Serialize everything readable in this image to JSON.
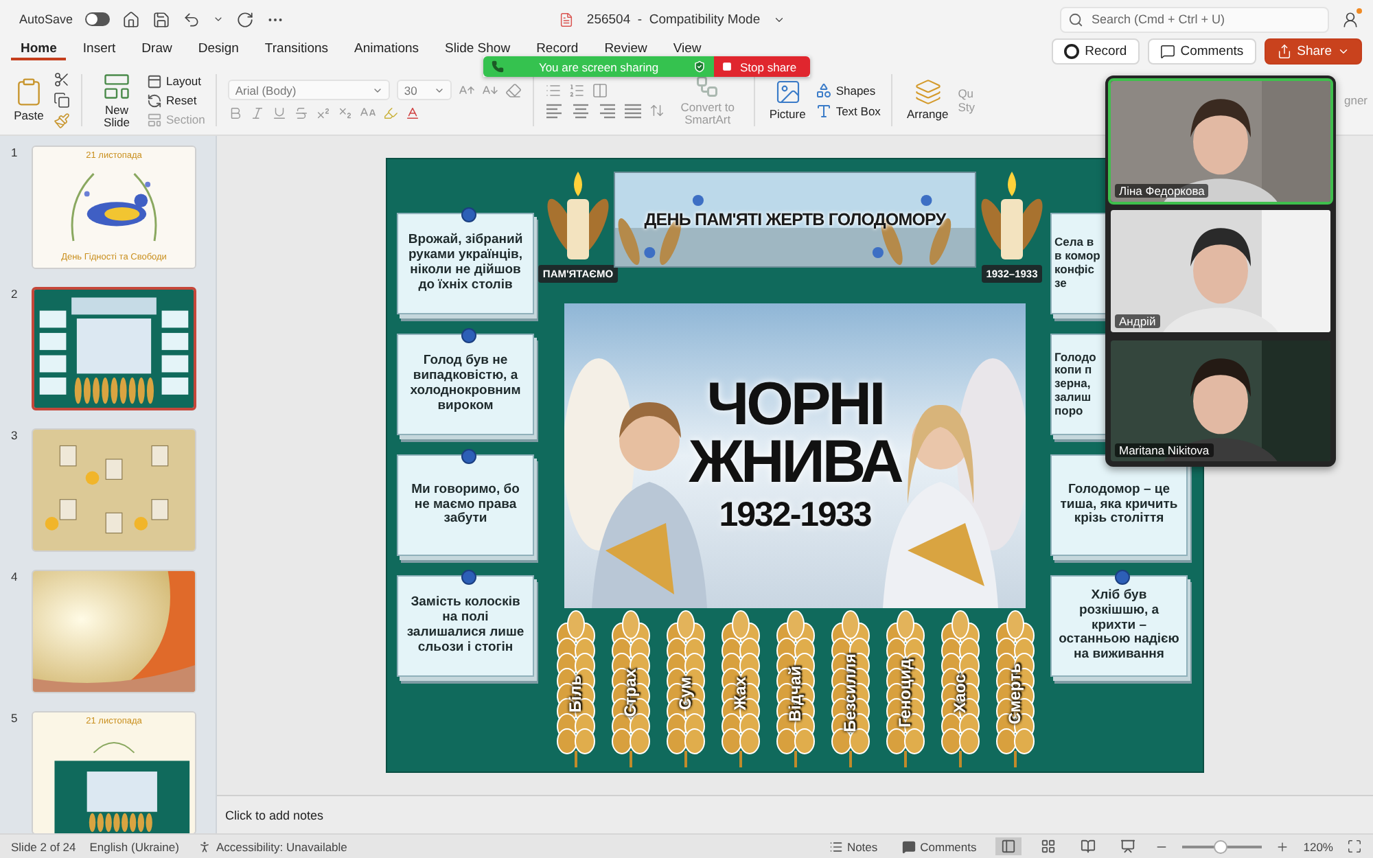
{
  "title_bar": {
    "autosave_label": "AutoSave",
    "autosave_on": false,
    "document_title": "256504  -  Compatibility Mode",
    "search": {
      "placeholder": "Search (Cmd + Ctrl + U)"
    }
  },
  "tabs": [
    {
      "label": "Home",
      "selected": true
    },
    {
      "label": "Insert",
      "selected": false
    },
    {
      "label": "Draw",
      "selected": false
    },
    {
      "label": "Design",
      "selected": false
    },
    {
      "label": "Transitions",
      "selected": false
    },
    {
      "label": "Animations",
      "selected": false
    },
    {
      "label": "Slide Show",
      "selected": false
    },
    {
      "label": "Record",
      "selected": false
    },
    {
      "label": "Review",
      "selected": false
    },
    {
      "label": "View",
      "selected": false
    }
  ],
  "header_buttons": [
    {
      "kind": "record",
      "label": "Record"
    },
    {
      "kind": "comments",
      "label": "Comments"
    },
    {
      "kind": "share",
      "label": "Share"
    }
  ],
  "ribbon": {
    "paste": "Paste",
    "new_slide": "New Slide",
    "slide_commands": [
      {
        "kind": "layout",
        "label": "Layout",
        "disabled": false
      },
      {
        "kind": "reset",
        "label": "Reset",
        "disabled": false
      },
      {
        "kind": "section",
        "label": "Section",
        "disabled": true
      }
    ],
    "font_name": "Arial (Body)",
    "font_size": "30",
    "smartart": {
      "label": "Convert to SmartArt",
      "disabled": true
    },
    "picture": "Picture",
    "shapes": "Shapes",
    "text_box": "Text Box",
    "arrange": "Arrange",
    "quick_styles": "Qu\nSty",
    "designer": "gner"
  },
  "sharing_banner": {
    "message": "You are screen sharing",
    "stop": "Stop share"
  },
  "thumbnails": [
    {
      "number": "1",
      "kind": "dove",
      "selected": false,
      "texts": [
        "21 листопада",
        "День Гідності та Свободи"
      ]
    },
    {
      "number": "2",
      "kind": "poster",
      "selected": true
    },
    {
      "number": "3",
      "kind": "portraits",
      "selected": false
    },
    {
      "number": "4",
      "kind": "gradient",
      "selected": false
    },
    {
      "number": "5",
      "kind": "collage",
      "selected": false,
      "texts": [
        "21 листопада"
      ]
    }
  ],
  "slide": {
    "banner_title": "ДЕНЬ ПАМ'ЯТІ ЖЕРТВ ГОЛОДОМОРУ",
    "left_candle_label": "ПАМ'ЯТАЄМО",
    "right_candle_label": "1932–1933",
    "left_cards": [
      "Врожай, зібраний руками українців, ніколи не дійшов до їхніх столів",
      "Голод був не випадковістю, а холоднокровним вироком",
      "Ми говоримо, бо не маємо права забути",
      "Замість колосків на полі залишалися лише сльози і стогін"
    ],
    "right_cards": [
      {
        "text": "Села в\nв комор\nконфіс\nзе",
        "covered": true
      },
      {
        "text": "Голодо\nкопи п\nзерна,\nзалиш\nпоро",
        "covered": true
      },
      {
        "text": "Голодомор – це тиша, яка кричить крізь століття",
        "covered": false
      },
      {
        "text": "Хліб був розкішшю, а крихти – останньою надією на виживання",
        "covered": false,
        "pin": true
      }
    ],
    "poster_title": "ЧОРНІ ЖНИВА",
    "poster_years": "1932-1933",
    "ears": [
      "Біль",
      "Страх",
      "Сум",
      "Жах",
      "Відчай",
      "Безсилля",
      "Геноцид",
      "Хаос",
      "Смерть"
    ]
  },
  "notes": {
    "placeholder": "Click to add notes"
  },
  "status_bar": {
    "slide_position": "Slide 2 of 24",
    "language": "English (Ukraine)",
    "accessibility": "Accessibility: Unavailable",
    "notes_button": "Notes",
    "comments_button": "Comments",
    "views": [
      {
        "kind": "normal",
        "selected": true
      },
      {
        "kind": "sorter",
        "selected": false
      },
      {
        "kind": "reading",
        "selected": false
      },
      {
        "kind": "slideshow",
        "selected": false
      }
    ],
    "zoom": {
      "level": 0.47,
      "reading": "120%"
    }
  },
  "video_call": {
    "participants": [
      {
        "name": "Ліна Федоркова",
        "speaking": true
      },
      {
        "name": "Андрій",
        "speaking": false
      },
      {
        "name": "Maritana Nikitova",
        "speaking": false
      }
    ]
  }
}
